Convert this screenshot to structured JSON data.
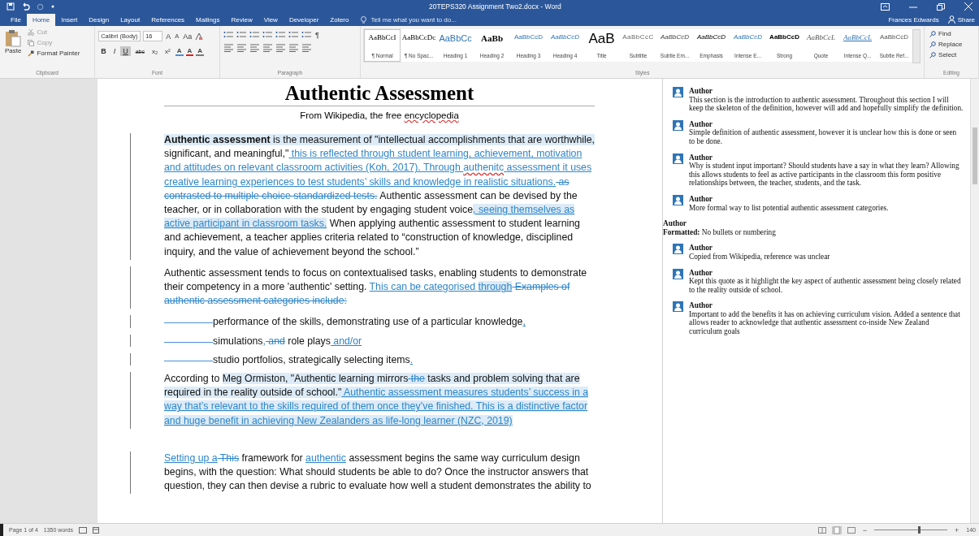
{
  "window": {
    "title": "20TEPS320 Assignment Two2.docx - Word",
    "user": "Frances Edwards",
    "share": "Share"
  },
  "tabs": [
    {
      "label": "File",
      "selected": false
    },
    {
      "label": "Home",
      "selected": true
    },
    {
      "label": "Insert",
      "selected": false
    },
    {
      "label": "Design",
      "selected": false
    },
    {
      "label": "Layout",
      "selected": false
    },
    {
      "label": "References",
      "selected": false
    },
    {
      "label": "Mailings",
      "selected": false
    },
    {
      "label": "Review",
      "selected": false
    },
    {
      "label": "View",
      "selected": false
    },
    {
      "label": "Developer",
      "selected": false
    },
    {
      "label": "Zotero",
      "selected": false
    }
  ],
  "tell_me": {
    "placeholder": "Tell me what you want to do..."
  },
  "clipboard": {
    "paste": "Paste",
    "cut": "Cut",
    "copy": "Copy",
    "format_painter": "Format Painter",
    "label": "Clipboard"
  },
  "font": {
    "name": "Calibri (Body)",
    "size": "16",
    "size_tools": [
      "A",
      "A",
      "Aa"
    ],
    "format_buttons": [
      {
        "label": "B",
        "kind": "bold",
        "selected": false
      },
      {
        "label": "I",
        "kind": "italic",
        "selected": false
      },
      {
        "label": "U",
        "kind": "underline",
        "selected": true
      },
      {
        "label": "abc",
        "kind": "strike",
        "selected": false
      },
      {
        "label": "x₂",
        "kind": "sub",
        "selected": false
      },
      {
        "label": "x²",
        "kind": "sup",
        "selected": false
      }
    ],
    "color_buttons": [
      {
        "label": "A",
        "color": "#4a90d9"
      },
      {
        "label": "A",
        "color": "#e02020"
      },
      {
        "label": "A",
        "color": "#7a7a7a"
      }
    ],
    "label": "Font"
  },
  "paragraph": {
    "pilcrow": "¶",
    "label": "Paragraph"
  },
  "styles": {
    "label": "Styles",
    "items": [
      {
        "sample": "AaBbCcI",
        "name": "¶ Normal",
        "kind": "normal",
        "selected": true
      },
      {
        "sample": "AaBbCcDc",
        "name": "¶ No Spac...",
        "kind": "nospace",
        "selected": false
      },
      {
        "sample": "AaBbCc",
        "name": "Heading 1",
        "kind": "h1",
        "selected": false
      },
      {
        "sample": "AaBb",
        "name": "Heading 2",
        "kind": "h2",
        "selected": false
      },
      {
        "sample": "AaBbCcD",
        "name": "Heading 3",
        "kind": "h3",
        "selected": false
      },
      {
        "sample": "AaBbCcD",
        "name": "Heading 4",
        "kind": "h4",
        "selected": false
      },
      {
        "sample": "AaB",
        "name": "Title",
        "kind": "title",
        "selected": false
      },
      {
        "sample": "AaBbCcC",
        "name": "Subtitle",
        "kind": "subtitle",
        "selected": false
      },
      {
        "sample": "AaBbCcD",
        "name": "Subtle Em...",
        "kind": "subtle",
        "selected": false
      },
      {
        "sample": "AaBbCcD",
        "name": "Emphasis",
        "kind": "emphasis",
        "selected": false
      },
      {
        "sample": "AaBbCcD",
        "name": "Intense E...",
        "kind": "intense",
        "selected": false
      },
      {
        "sample": "AaBbCcD",
        "name": "Strong",
        "kind": "strong",
        "selected": false
      },
      {
        "sample": "AaBbCcL",
        "name": "Quote",
        "kind": "quote",
        "selected": false
      },
      {
        "sample": "AaBbCcL",
        "name": "Intense Q...",
        "kind": "iquote",
        "selected": false
      },
      {
        "sample": "AaBbCcD",
        "name": "Subtle Ref...",
        "kind": "sref",
        "selected": false
      }
    ]
  },
  "editing": {
    "label": "Editing",
    "items": [
      "Find",
      "Replace",
      "Select"
    ]
  },
  "document": {
    "title": "Authentic Assessment",
    "subtitle": [
      {
        "text": "From Wikipedia, the free ",
        "kind": "plain"
      },
      {
        "text": "encyclopedia",
        "kind": "spell"
      }
    ],
    "paragraphs": [
      {
        "kind": "body",
        "runs": [
          {
            "text": "Authentic assessment",
            "kind": "bold",
            "commented": true
          },
          {
            "text": " is the measurement of \"intellectual accomplishments that are worthwhile,",
            "kind": "plain",
            "commented": true
          },
          {
            "text": " significant, and meaningful,\"",
            "kind": "plain",
            "commented": false
          },
          {
            "text": " this is reflected through student learning, achievement, motivation and attitudes on relevant classroom activities (Koh, 2017). Through ",
            "kind": "ins",
            "commented": false
          },
          {
            "text": "authenitc",
            "kind": "insspell",
            "commented": false
          },
          {
            "text": " assessment it uses creative learning experiences to test students’ skills and knowledge in realistic situations.",
            "kind": "ins",
            "commented": false
          },
          {
            "text": " as contrasted to multiple choice standardized tests.",
            "kind": "del",
            "commented": false
          },
          {
            "text": " Authentic assessment can be devised by the teacher, or in collaboration with the student by engaging student voice",
            "kind": "plain",
            "commented": false
          },
          {
            "text": ", seeing themselves as active participant in classroom tasks.",
            "kind": "ins",
            "commented": true
          },
          {
            "text": " When applying authentic assessment to student learning and achievement, a teacher applies criteria related to “construction of knowledge, disciplined inquiry, and the value of achievement beyond the school.”",
            "kind": "plain",
            "commented": false
          }
        ]
      },
      {
        "kind": "body",
        "runs": [
          {
            "text": "Authentic assessment tends to focus on contextualised tasks, enabling students to demonstrate their competency in a more 'authentic' setting. ",
            "kind": "plain",
            "commented": false
          },
          {
            "text": "This can be categorised ",
            "kind": "ins",
            "commented": false
          },
          {
            "text": "through",
            "kind": "ins",
            "commented": true
          },
          {
            "text": " Examples of authentic assessment categories include:",
            "kind": "del",
            "commented": false
          }
        ]
      },
      {
        "kind": "list",
        "runs": [
          {
            "text": "performance of the skills, demonstrating use of a particular knowledge",
            "kind": "plain",
            "commented": false
          },
          {
            "text": ",",
            "kind": "ins",
            "commented": false
          }
        ]
      },
      {
        "kind": "list",
        "runs": [
          {
            "text": "simulations",
            "kind": "plain",
            "commented": false
          },
          {
            "text": ",",
            "kind": "ins",
            "commented": false
          },
          {
            "text": " and",
            "kind": "del",
            "commented": false
          },
          {
            "text": " role plays",
            "kind": "plain",
            "commented": false
          },
          {
            "text": " and/or",
            "kind": "ins",
            "commented": false
          }
        ]
      },
      {
        "kind": "list",
        "runs": [
          {
            "text": "studio portfolios, strategically selecting items",
            "kind": "plain",
            "commented": false
          },
          {
            "text": ".",
            "kind": "ins",
            "commented": false
          }
        ]
      },
      {
        "kind": "body",
        "runs": [
          {
            "text": "According to ",
            "kind": "plain",
            "commented": false
          },
          {
            "text": "Meg Ormiston, \"Authentic learning mirrors",
            "kind": "plain",
            "commented": true
          },
          {
            "text": " the",
            "kind": "del",
            "commented": true
          },
          {
            "text": " tasks and problem solving that are required in the reality outside of school.\"",
            "kind": "plain",
            "commented": true
          },
          {
            "text": " Authentic assessment measures students’ success in a way that’s relevant to the skills required of them once they’ve finished. This is a distinctive factor and huge benefit in achieving New Zealanders as life-long learner (NZC, 2019)",
            "kind": "ins",
            "commented": true
          }
        ]
      },
      {
        "kind": "gap",
        "runs": [
          {
            "text": "Setting up a",
            "kind": "ins",
            "commented": false
          },
          {
            "text": " This",
            "kind": "del",
            "commented": false
          },
          {
            "text": " framework for ",
            "kind": "plain",
            "commented": false
          },
          {
            "text": "authentic",
            "kind": "ins",
            "commented": false
          },
          {
            "text": " assessment begins the same way curriculum design begins, with the question: What should students be able to do? Once the instructor answers that question, they can then devise a rubric to evaluate how well a student demonstrates the ability to",
            "kind": "plain",
            "commented": false
          }
        ]
      }
    ]
  },
  "comments": [
    {
      "kind": "comment",
      "author": "Author",
      "text": "This section is the introduction to authentic assessment. Throughout this section I will keep the skeleton of the definition, however will add and hopefully simplify the definition."
    },
    {
      "kind": "comment",
      "author": "Author",
      "text": "Simple definition of authentic assessment, however it is unclear how this is done or seen to be done."
    },
    {
      "kind": "comment",
      "author": "Author",
      "text": "Why is student input important? Should students have a say in what they learn? Allowing this allows students to feel as active participants in the classroom this form positive relationships between, the teacher, students, and the task."
    },
    {
      "kind": "comment",
      "author": "Author",
      "text": "More formal way to list potential authentic assessment categories."
    },
    {
      "kind": "format",
      "author": "Author",
      "text": "**Formatted:**  No bullets or numbering"
    },
    {
      "kind": "comment",
      "author": "Author",
      "text": "Copied from Wikipedia, reference was unclear"
    },
    {
      "kind": "comment",
      "author": "Author",
      "text": "Kept this quote as it highlight the key aspect of authentic assessment being closely related to the reality outside of school."
    },
    {
      "kind": "comment",
      "author": "Author",
      "text": "Important to add the benefits it has on achieving curriculum vision. Added a sentence that allows reader to acknowledge that authentic assessment co-inside New Zealand curriculum goals"
    }
  ],
  "status_bar": {
    "page": "Page 1 of 4",
    "words": "1350 words",
    "zoom": "140",
    "zoom_out": "−",
    "zoom_in": "+",
    "zoom_slider": {
      "level": 0.6
    }
  }
}
